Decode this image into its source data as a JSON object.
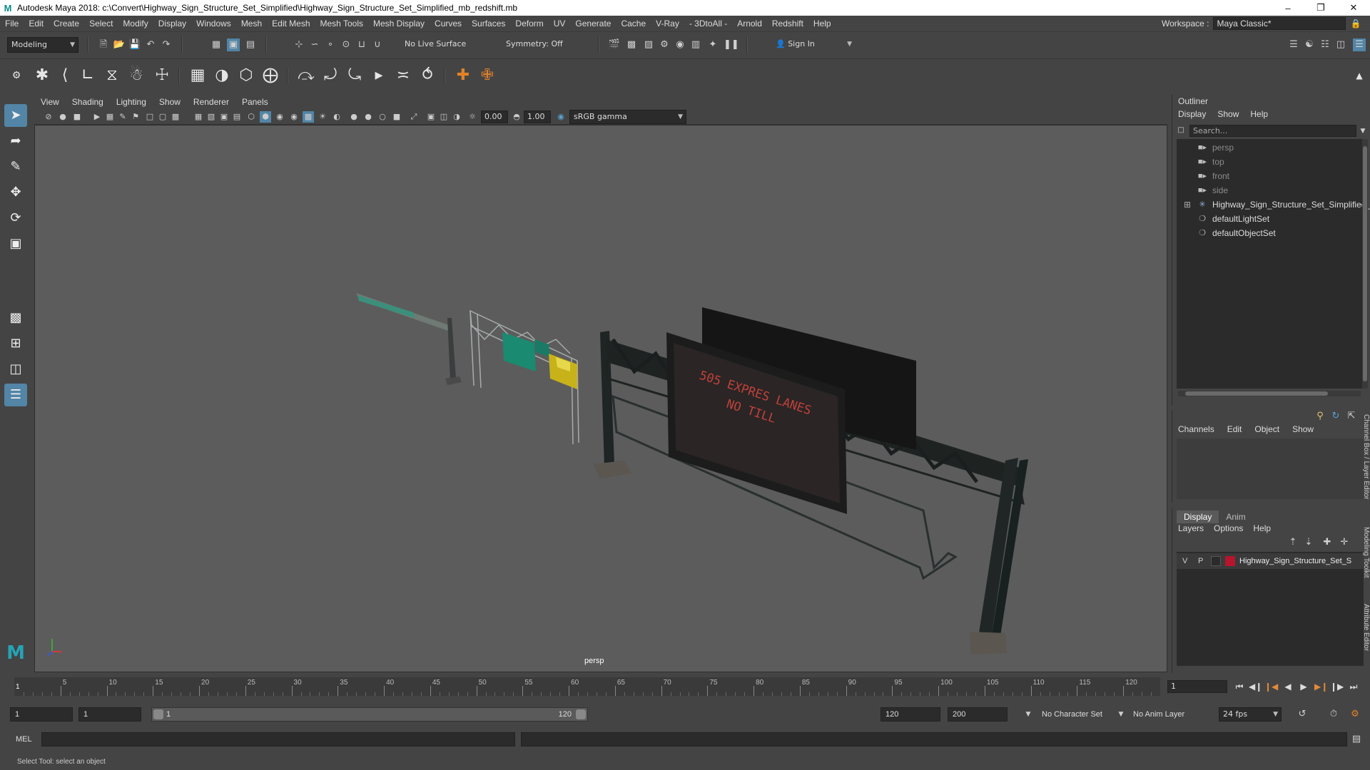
{
  "window": {
    "title": "Autodesk Maya 2018: c:\\Convert\\Highway_Sign_Structure_Set_Simplified\\Highway_Sign_Structure_Set_Simplified_mb_redshift.mb",
    "logo": "M",
    "controls": [
      "minimize-icon",
      "maximize-icon",
      "close-icon"
    ]
  },
  "menubar": {
    "items": [
      "File",
      "Edit",
      "Create",
      "Select",
      "Modify",
      "Display",
      "Windows",
      "Mesh",
      "Edit Mesh",
      "Mesh Tools",
      "Mesh Display",
      "Curves",
      "Surfaces",
      "Deform",
      "UV",
      "Generate",
      "Cache",
      "V-Ray",
      "- 3DtoAll -",
      "Arnold",
      "Redshift",
      "Help"
    ],
    "workspace_label": "Workspace :",
    "workspace_value": "Maya Classic*"
  },
  "statusline": {
    "mode": "Modeling",
    "live_surface": "No Live Surface",
    "symmetry": "Symmetry: Off",
    "sign_in": "Sign In"
  },
  "viewport_menu": [
    "View",
    "Shading",
    "Lighting",
    "Show",
    "Renderer",
    "Panels"
  ],
  "viewport_tools": {
    "exposure": "0.00",
    "gamma": "1.00",
    "color_space": "sRGB gamma"
  },
  "viewport": {
    "camera_label": "persp",
    "sign_text_line1": "505 EXPRES LANES",
    "sign_text_line2": "NO TILL"
  },
  "outliner": {
    "title": "Outliner",
    "menu": [
      "Display",
      "Show",
      "Help"
    ],
    "search_placeholder": "Search...",
    "items": [
      {
        "label": "persp",
        "icon": "camera-icon",
        "dim": true
      },
      {
        "label": "top",
        "icon": "camera-icon",
        "dim": true
      },
      {
        "label": "front",
        "icon": "camera-icon",
        "dim": true
      },
      {
        "label": "side",
        "icon": "camera-icon",
        "dim": true
      },
      {
        "label": "Highway_Sign_Structure_Set_Simplified_",
        "icon": "group-icon",
        "dim": false,
        "expand": "⊞"
      },
      {
        "label": "defaultLightSet",
        "icon": "set-icon",
        "dim": false
      },
      {
        "label": "defaultObjectSet",
        "icon": "set-icon",
        "dim": false
      }
    ]
  },
  "channel_box": {
    "menu": [
      "Channels",
      "Edit",
      "Object",
      "Show"
    ]
  },
  "layer_editor": {
    "tabs": [
      "Display",
      "Anim"
    ],
    "menu": [
      "Layers",
      "Options",
      "Help"
    ],
    "layer": {
      "v": "V",
      "p": "P",
      "name": "Highway_Sign_Structure_Set_S",
      "color": "#b5152d"
    }
  },
  "side_tabs": [
    "Channel Box / Layer Editor",
    "Modeling Toolkit",
    "Attribute Editor"
  ],
  "timeline": {
    "ticks": [
      5,
      10,
      15,
      20,
      25,
      30,
      35,
      40,
      45,
      50,
      55,
      60,
      65,
      70,
      75,
      80,
      85,
      90,
      95,
      100,
      105,
      110,
      115,
      120
    ],
    "start_frame_mark": "1",
    "current_frame": "1"
  },
  "range": {
    "start": "1",
    "anim_start": "1",
    "range_start": "1",
    "range_end": "120",
    "anim_end": "120",
    "end": "200",
    "character_set": "No Character Set",
    "anim_layer": "No Anim Layer",
    "fps": "24 fps"
  },
  "command_line": {
    "label": "MEL"
  },
  "help_line": {
    "text": "Select Tool: select an object"
  },
  "colors": {
    "ui_bg": "#444444",
    "viewport_bg": "#5c5c5c",
    "selected_tool": "#5285a6",
    "sign_text": "#c0413a"
  }
}
